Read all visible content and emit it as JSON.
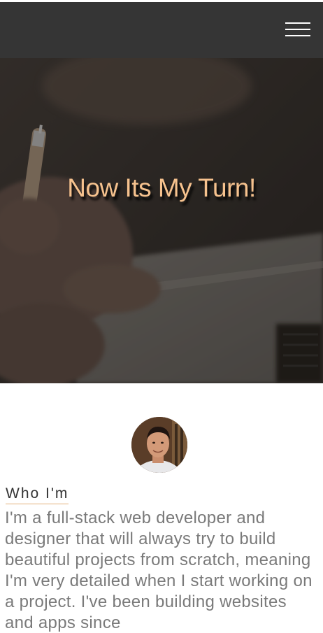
{
  "navbar": {
    "background": "#353535",
    "menu_icon": "hamburger-menu-icon"
  },
  "hero": {
    "title": "Now Its My Turn!",
    "title_color": "#f6c28e"
  },
  "about": {
    "heading": "Who I'm",
    "body": "I'm a full-stack web developer and designer that will always try to build beautiful projects from scratch, meaning I'm very detailed when I start working on a project. I've been building websites and apps since",
    "accent_color": "#e2b07b"
  }
}
